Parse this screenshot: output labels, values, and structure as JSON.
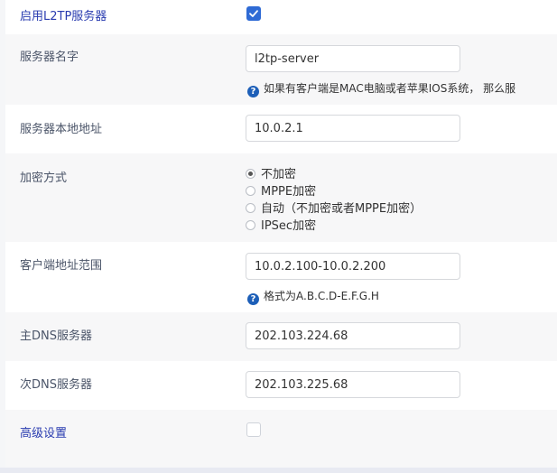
{
  "enable_l2tp": {
    "label": "启用L2TP服务器",
    "checked": true
  },
  "server_name": {
    "label": "服务器名字",
    "value": "l2tp-server",
    "hint": "如果有客户端是MAC电脑或者苹果IOS系统， 那么服"
  },
  "local_address": {
    "label": "服务器本地地址",
    "value": "10.0.2.1"
  },
  "encryption": {
    "label": "加密方式",
    "options": [
      "不加密",
      "MPPE加密",
      "自动（不加密或者MPPE加密）",
      "IPSec加密"
    ],
    "selected": "不加密"
  },
  "client_range": {
    "label": "客户端地址范围",
    "value": "10.0.2.100-10.0.2.200",
    "hint": "格式为A.B.C.D-E.F.G.H"
  },
  "primary_dns": {
    "label": "主DNS服务器",
    "value": "202.103.224.68"
  },
  "secondary_dns": {
    "label": "次DNS服务器",
    "value": "202.103.225.68"
  },
  "advanced": {
    "label": "高级设置",
    "checked": false
  },
  "hint_icon_glyph": "?",
  "colors": {
    "accent": "#2f6bd5",
    "hint_icon": "#1d5fb8",
    "label_blue": "#2a3cb0",
    "row_shade": "#f7f7f8"
  }
}
